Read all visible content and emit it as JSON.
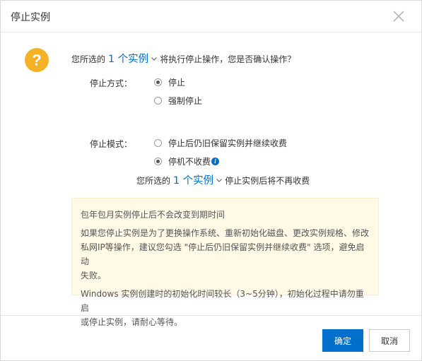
{
  "dialog": {
    "title": "停止实例",
    "close_icon": "close-icon"
  },
  "prompt": {
    "prefix": "您所选的",
    "count_link": "1 个实例",
    "suffix": "将执行停止操作，您是否确认操作？",
    "icon": "question-icon",
    "icon_color": "#f5b226"
  },
  "stop_method": {
    "label": "停止方式：",
    "options": [
      {
        "label": "停止",
        "checked": true
      },
      {
        "label": "强制停止",
        "checked": false
      }
    ]
  },
  "stop_mode": {
    "label": "停止模式：",
    "options": [
      {
        "label": "停止后仍旧保留实例并继续收费",
        "checked": false
      },
      {
        "label": "停机不收费",
        "checked": true
      }
    ],
    "info_icon": "info-icon"
  },
  "billing_note": {
    "prefix": "您所选的",
    "count_link": "1 个实例",
    "suffix": "停止实例后将不再收费"
  },
  "tips": {
    "line1": "包年包月实例停止后不会改变到期时间",
    "line2a": "如果您停止实例是为了更换操作系统、重新初始化磁盘、更改实例规格、修改",
    "line2b": "私网IP等操作，建议您勾选 \"停止后仍旧保留实例并继续收费\" 选项，避免启动",
    "line2c": "失败。",
    "line3a": "Windows 实例创建时的初始化时间较长（3~5分钟），初始化过程中请勿重启",
    "line3b": "或停止实例，请耐心等待。",
    "background_color": "#fff9e5"
  },
  "footer": {
    "confirm_label": "确定",
    "cancel_label": "取消",
    "accent_color": "#0070cc"
  }
}
